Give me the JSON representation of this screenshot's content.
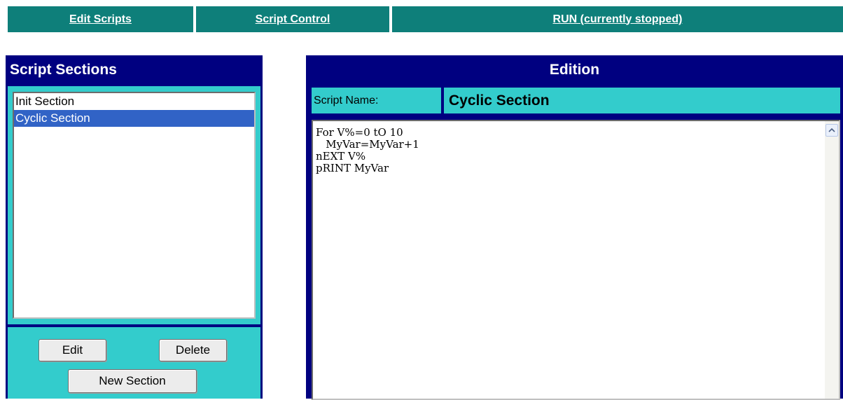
{
  "nav": {
    "tabs": [
      {
        "label": "Edit Scripts"
      },
      {
        "label": "Script Control"
      },
      {
        "label": "RUN (currently stopped)"
      }
    ]
  },
  "sections_panel": {
    "title": "Script Sections",
    "items": [
      {
        "label": "Init Section",
        "selected": false
      },
      {
        "label": "Cyclic Section",
        "selected": true
      }
    ],
    "edit_label": "Edit",
    "delete_label": "Delete",
    "new_section_label": "New Section"
  },
  "edition_panel": {
    "title": "Edition",
    "script_name_label": "Script Name:",
    "script_name_value": "Cyclic Section",
    "script_text": "For V%=0 tO 10\n   MyVar=MyVar+1\nnEXT V%\npRINT MyVar"
  },
  "colors": {
    "nav_bg": "#0e7f7a",
    "panel_bg": "#000080",
    "accent_cyan": "#33cccc",
    "selection": "#3163c6"
  },
  "icons": [
    "chevron-up-icon"
  ]
}
